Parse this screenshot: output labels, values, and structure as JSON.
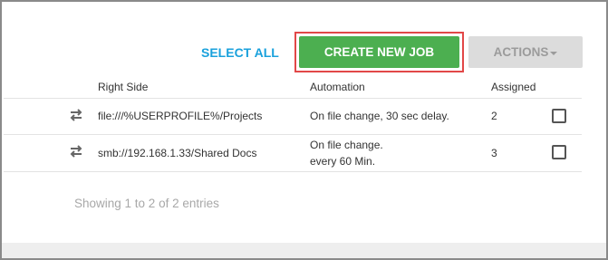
{
  "toolbar": {
    "select_all_label": "SELECT ALL",
    "create_job_label": "CREATE NEW JOB",
    "actions_label": "ACTIONS"
  },
  "table": {
    "headers": {
      "right_side": "Right Side",
      "automation": "Automation",
      "assigned": "Assigned"
    },
    "rows": [
      {
        "right_side": "file:///%USERPROFILE%/Projects",
        "automation_line1": "On file change, 30 sec delay.",
        "automation_line2": "",
        "assigned": "2",
        "checked": false
      },
      {
        "right_side": "smb://192.168.1.33/Shared Docs",
        "automation_line1": "On file change.",
        "automation_line2": "every 60 Min.",
        "assigned": "3",
        "checked": false
      }
    ]
  },
  "footer": {
    "info": "Showing 1 to 2 of 2 entries"
  },
  "icons": {
    "sync": "swap-horizontal-icon",
    "actions_caret": "caret-down-icon"
  },
  "colors": {
    "primary": "#4caf50",
    "link": "#1aa1dc",
    "highlight": "#e24848"
  }
}
